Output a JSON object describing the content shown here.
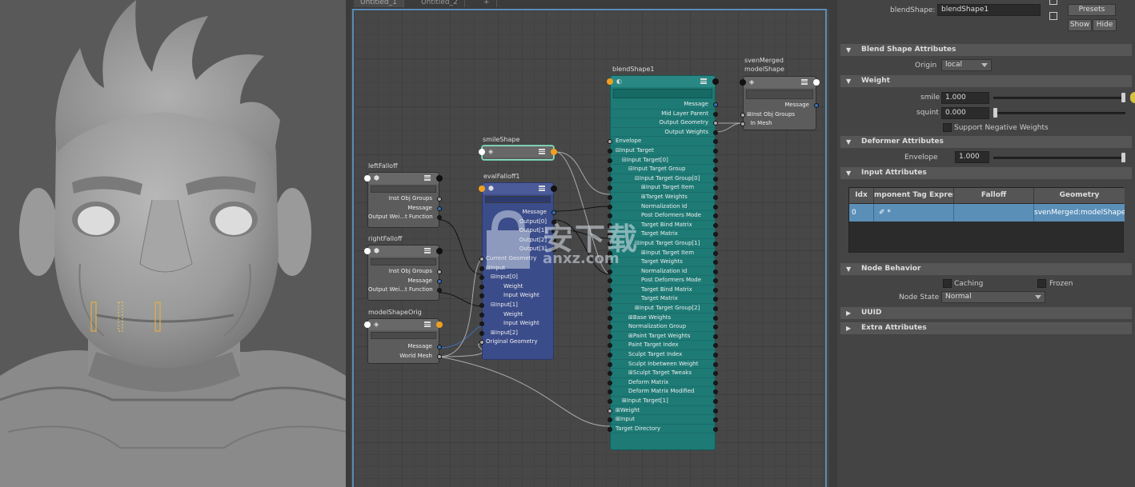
{
  "editor": {
    "tabs": [
      "Untitled_1",
      "Untitled_2",
      "+"
    ]
  },
  "nodes": {
    "leftFalloff": {
      "title": "leftFalloff",
      "ports": [
        "Inst Obj Groups",
        "Message",
        "Output Wei...t Function"
      ]
    },
    "rightFalloff": {
      "title": "rightFalloff",
      "ports": [
        "Inst Obj Groups",
        "Message",
        "Output Wei...t Function"
      ]
    },
    "modelShapeOrig": {
      "title": "modelShapeOrig",
      "ports": [
        "Message",
        "World Mesh"
      ]
    },
    "smileShape": {
      "title": "smileShape"
    },
    "evalFalloff": {
      "title": "evalFalloff1",
      "outputs": [
        "Message",
        "Output[0]",
        "Output[1]",
        "Output[2]",
        "Output[3]"
      ],
      "inputs": [
        "Current Geometry",
        "Input",
        "Input[0]",
        "Weight",
        "Input Weight",
        "Input[1]",
        "Weight",
        "Input Weight",
        "Input[2]",
        "Original Geometry"
      ]
    },
    "blendShape": {
      "title": "blendShape1",
      "outputs": [
        "Message",
        "Mid Layer Parent",
        "Output Geometry",
        "Output Weights"
      ],
      "inputs": [
        "Envelope",
        "Input Target",
        "Input Target[0]",
        "Input Target Group",
        "Input Target Group[0]",
        "Input Target Item",
        "Target Weights",
        "Normalization Id",
        "Post Deformers Mode",
        "Target Bind Matrix",
        "Target Matrix",
        "Input Target Group[1]",
        "Input Target Item",
        "Target Weights",
        "Normalization Id",
        "Post Deformers Mode",
        "Target Bind Matrix",
        "Target Matrix",
        "Input Target Group[2]",
        "Base Weights",
        "Normalization Group",
        "Paint Target Weights",
        "Paint Target Index",
        "Sculpt Target Index",
        "Sculpt Inbetween Weight",
        "Sculpt Target Tweaks",
        "Deform Matrix",
        "Deform Matrix Modified",
        "Input Target[1]",
        "Weight",
        "Input",
        "Target Directory"
      ]
    },
    "svenMerged": {
      "title_line1": "svenMerged",
      "title_line2": "modelShape",
      "outputs": [
        "Message"
      ],
      "inputs": [
        "Inst Obj Groups",
        "In Mesh"
      ]
    }
  },
  "watermark": {
    "text": "安下载",
    "url": "anxz.com"
  },
  "attr": {
    "node_label": "blendShape:",
    "node_value": "blendShape1",
    "presets": "Presets",
    "show": "Show",
    "hide": "Hide",
    "sections": {
      "blend": "Blend Shape Attributes",
      "weight": "Weight",
      "deformer": "Deformer Attributes",
      "input": "Input Attributes",
      "behavior": "Node Behavior",
      "uuid": "UUID",
      "extra": "Extra Attributes"
    },
    "origin_label": "Origin",
    "origin_value": "local",
    "smile_label": "smile",
    "smile_value": "1.000",
    "smile_fraction": 1.0,
    "squint_label": "squint",
    "squint_value": "0.000",
    "squint_fraction": 0.0,
    "support_neg": "Support Negative Weights",
    "envelope_label": "Envelope",
    "envelope_value": "1.000",
    "envelope_fraction": 1.0,
    "table": {
      "headers": [
        "Idx",
        "mponent Tag Expressi",
        "Falloff",
        "Geometry"
      ],
      "row": [
        "0",
        "✐ *",
        "",
        "svenMerged:modelShape"
      ]
    },
    "caching": "Caching",
    "frozen": "Frozen",
    "node_state_label": "Node State",
    "node_state_value": "Normal"
  }
}
